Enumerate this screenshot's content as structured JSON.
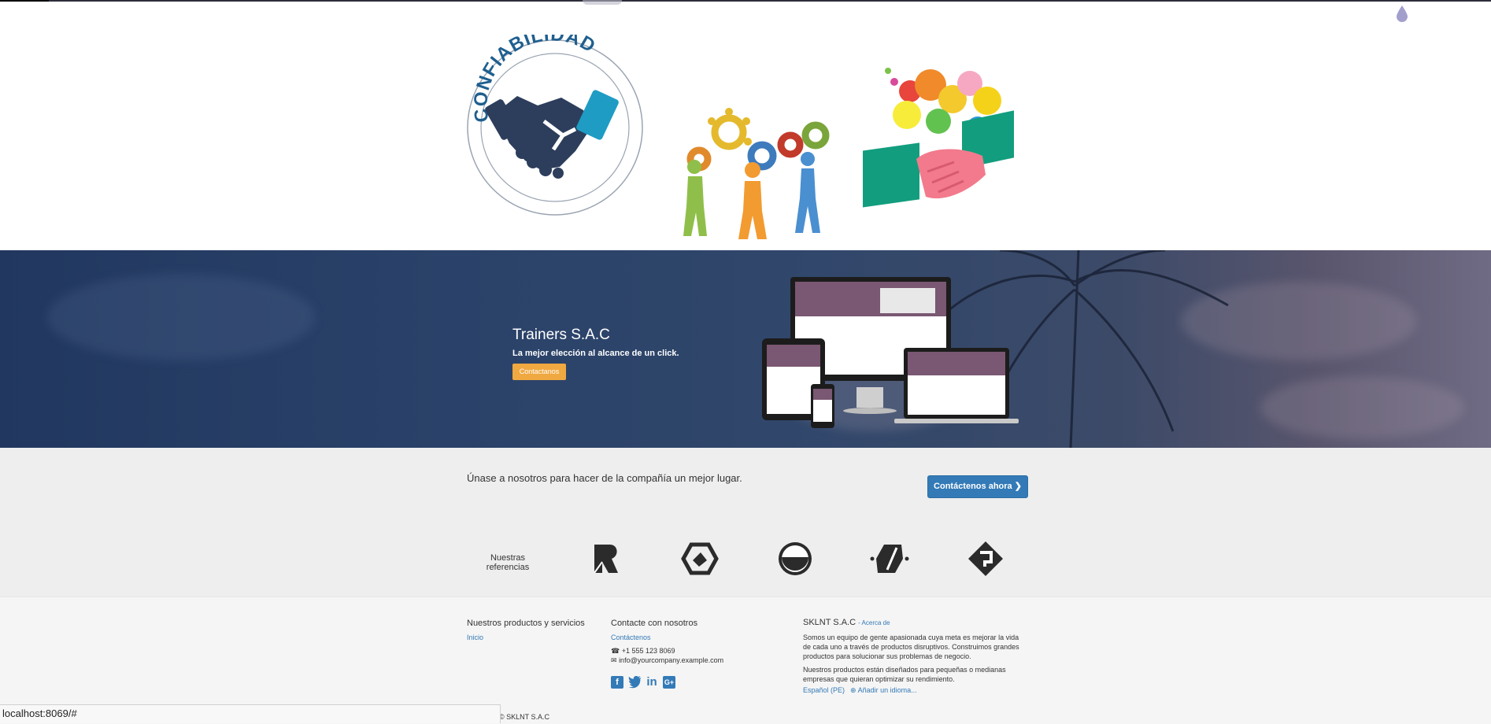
{
  "banner": {
    "title": "Trainers S.A.C",
    "subtitle": "La mejor elección al alcance de un click.",
    "button_label": "Contactanos"
  },
  "images": {
    "reliability_badge_text": "CONFIABILIDAD"
  },
  "join": {
    "text": "Únase a nosotros para hacer de la compañía un mejor lugar.",
    "button_label": "Contáctenos ahora",
    "button_icon": "chevron-right-icon"
  },
  "references": {
    "label": "Nuestras referencias",
    "logos": [
      "logo-r",
      "logo-hexagon",
      "logo-circle",
      "logo-parallelogram",
      "logo-diamond"
    ]
  },
  "footer": {
    "products": {
      "title": "Nuestros productos y servicios",
      "links": [
        "Inicio"
      ]
    },
    "contact": {
      "title": "Contacte con nosotros",
      "link": "Contáctenos",
      "phone": "+1 555 123 8069",
      "email": "info@yourcompany.example.com",
      "social": [
        "facebook-icon",
        "twitter-icon",
        "linkedin-icon",
        "google-plus-icon"
      ]
    },
    "about": {
      "company": "SKLNT S.A.C",
      "about_link": "- Acerca de",
      "paragraph1": "Somos un equipo de gente apasionada cuya meta es mejorar la vida de cada uno a través de productos disruptivos. Construimos grandes productos para solucionar sus problemas de negocio.",
      "paragraph2": "Nuestros productos están diseñados para pequeñas o medianas empresas que quieran optimizar su rendimiento.",
      "language": "Español (PE)",
      "add_language": "Añadir un idioma..."
    },
    "copyright": "© SKLNT S.A.C"
  },
  "status_bar": {
    "url": "localhost:8069/#"
  },
  "colors": {
    "primary": "#337ab7",
    "accent_orange": "#f0a840",
    "banner_dark": "#21375f"
  }
}
